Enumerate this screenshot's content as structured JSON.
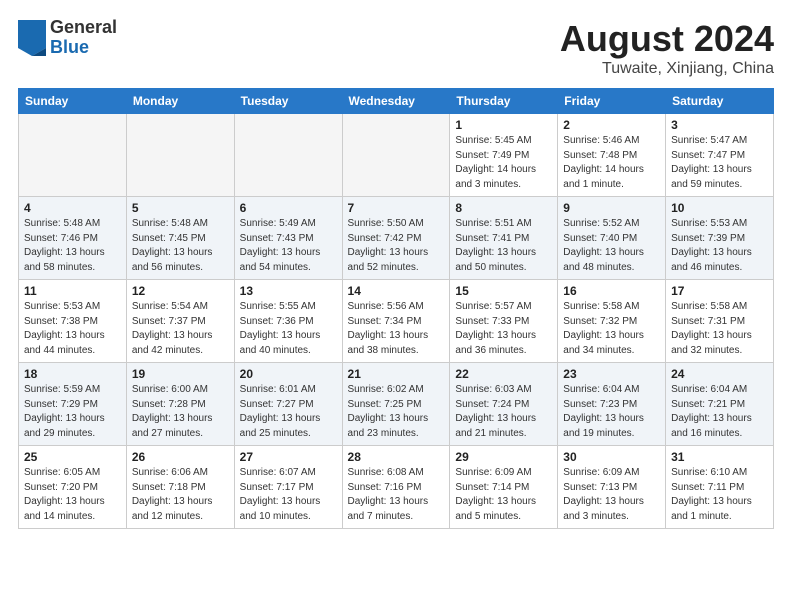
{
  "header": {
    "logo_general": "General",
    "logo_blue": "Blue",
    "main_title": "August 2024",
    "sub_title": "Tuwaite, Xinjiang, China"
  },
  "calendar": {
    "weekdays": [
      "Sunday",
      "Monday",
      "Tuesday",
      "Wednesday",
      "Thursday",
      "Friday",
      "Saturday"
    ],
    "rows": [
      [
        {
          "day": "",
          "info": ""
        },
        {
          "day": "",
          "info": ""
        },
        {
          "day": "",
          "info": ""
        },
        {
          "day": "",
          "info": ""
        },
        {
          "day": "1",
          "info": "Sunrise: 5:45 AM\nSunset: 7:49 PM\nDaylight: 14 hours\nand 3 minutes."
        },
        {
          "day": "2",
          "info": "Sunrise: 5:46 AM\nSunset: 7:48 PM\nDaylight: 14 hours\nand 1 minute."
        },
        {
          "day": "3",
          "info": "Sunrise: 5:47 AM\nSunset: 7:47 PM\nDaylight: 13 hours\nand 59 minutes."
        }
      ],
      [
        {
          "day": "4",
          "info": "Sunrise: 5:48 AM\nSunset: 7:46 PM\nDaylight: 13 hours\nand 58 minutes."
        },
        {
          "day": "5",
          "info": "Sunrise: 5:48 AM\nSunset: 7:45 PM\nDaylight: 13 hours\nand 56 minutes."
        },
        {
          "day": "6",
          "info": "Sunrise: 5:49 AM\nSunset: 7:43 PM\nDaylight: 13 hours\nand 54 minutes."
        },
        {
          "day": "7",
          "info": "Sunrise: 5:50 AM\nSunset: 7:42 PM\nDaylight: 13 hours\nand 52 minutes."
        },
        {
          "day": "8",
          "info": "Sunrise: 5:51 AM\nSunset: 7:41 PM\nDaylight: 13 hours\nand 50 minutes."
        },
        {
          "day": "9",
          "info": "Sunrise: 5:52 AM\nSunset: 7:40 PM\nDaylight: 13 hours\nand 48 minutes."
        },
        {
          "day": "10",
          "info": "Sunrise: 5:53 AM\nSunset: 7:39 PM\nDaylight: 13 hours\nand 46 minutes."
        }
      ],
      [
        {
          "day": "11",
          "info": "Sunrise: 5:53 AM\nSunset: 7:38 PM\nDaylight: 13 hours\nand 44 minutes."
        },
        {
          "day": "12",
          "info": "Sunrise: 5:54 AM\nSunset: 7:37 PM\nDaylight: 13 hours\nand 42 minutes."
        },
        {
          "day": "13",
          "info": "Sunrise: 5:55 AM\nSunset: 7:36 PM\nDaylight: 13 hours\nand 40 minutes."
        },
        {
          "day": "14",
          "info": "Sunrise: 5:56 AM\nSunset: 7:34 PM\nDaylight: 13 hours\nand 38 minutes."
        },
        {
          "day": "15",
          "info": "Sunrise: 5:57 AM\nSunset: 7:33 PM\nDaylight: 13 hours\nand 36 minutes."
        },
        {
          "day": "16",
          "info": "Sunrise: 5:58 AM\nSunset: 7:32 PM\nDaylight: 13 hours\nand 34 minutes."
        },
        {
          "day": "17",
          "info": "Sunrise: 5:58 AM\nSunset: 7:31 PM\nDaylight: 13 hours\nand 32 minutes."
        }
      ],
      [
        {
          "day": "18",
          "info": "Sunrise: 5:59 AM\nSunset: 7:29 PM\nDaylight: 13 hours\nand 29 minutes."
        },
        {
          "day": "19",
          "info": "Sunrise: 6:00 AM\nSunset: 7:28 PM\nDaylight: 13 hours\nand 27 minutes."
        },
        {
          "day": "20",
          "info": "Sunrise: 6:01 AM\nSunset: 7:27 PM\nDaylight: 13 hours\nand 25 minutes."
        },
        {
          "day": "21",
          "info": "Sunrise: 6:02 AM\nSunset: 7:25 PM\nDaylight: 13 hours\nand 23 minutes."
        },
        {
          "day": "22",
          "info": "Sunrise: 6:03 AM\nSunset: 7:24 PM\nDaylight: 13 hours\nand 21 minutes."
        },
        {
          "day": "23",
          "info": "Sunrise: 6:04 AM\nSunset: 7:23 PM\nDaylight: 13 hours\nand 19 minutes."
        },
        {
          "day": "24",
          "info": "Sunrise: 6:04 AM\nSunset: 7:21 PM\nDaylight: 13 hours\nand 16 minutes."
        }
      ],
      [
        {
          "day": "25",
          "info": "Sunrise: 6:05 AM\nSunset: 7:20 PM\nDaylight: 13 hours\nand 14 minutes."
        },
        {
          "day": "26",
          "info": "Sunrise: 6:06 AM\nSunset: 7:18 PM\nDaylight: 13 hours\nand 12 minutes."
        },
        {
          "day": "27",
          "info": "Sunrise: 6:07 AM\nSunset: 7:17 PM\nDaylight: 13 hours\nand 10 minutes."
        },
        {
          "day": "28",
          "info": "Sunrise: 6:08 AM\nSunset: 7:16 PM\nDaylight: 13 hours\nand 7 minutes."
        },
        {
          "day": "29",
          "info": "Sunrise: 6:09 AM\nSunset: 7:14 PM\nDaylight: 13 hours\nand 5 minutes."
        },
        {
          "day": "30",
          "info": "Sunrise: 6:09 AM\nSunset: 7:13 PM\nDaylight: 13 hours\nand 3 minutes."
        },
        {
          "day": "31",
          "info": "Sunrise: 6:10 AM\nSunset: 7:11 PM\nDaylight: 13 hours\nand 1 minute."
        }
      ]
    ]
  }
}
